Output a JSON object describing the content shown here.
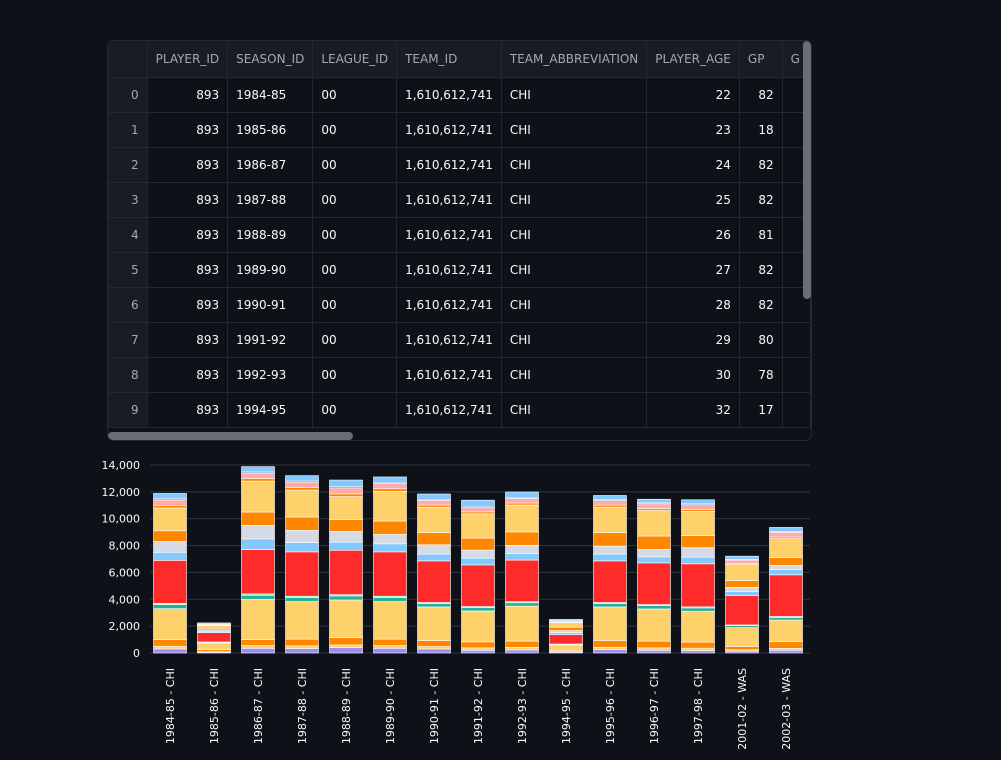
{
  "table": {
    "columns": [
      "",
      "PLAYER_ID",
      "SEASON_ID",
      "LEAGUE_ID",
      "TEAM_ID",
      "TEAM_ABBREVIATION",
      "PLAYER_AGE",
      "GP",
      "G"
    ],
    "rows": [
      [
        "0",
        "893",
        "1984-85",
        "00",
        "1,610,612,741",
        "CHI",
        "22",
        "82",
        ""
      ],
      [
        "1",
        "893",
        "1985-86",
        "00",
        "1,610,612,741",
        "CHI",
        "23",
        "18",
        ""
      ],
      [
        "2",
        "893",
        "1986-87",
        "00",
        "1,610,612,741",
        "CHI",
        "24",
        "82",
        ""
      ],
      [
        "3",
        "893",
        "1987-88",
        "00",
        "1,610,612,741",
        "CHI",
        "25",
        "82",
        ""
      ],
      [
        "4",
        "893",
        "1988-89",
        "00",
        "1,610,612,741",
        "CHI",
        "26",
        "81",
        ""
      ],
      [
        "5",
        "893",
        "1989-90",
        "00",
        "1,610,612,741",
        "CHI",
        "27",
        "82",
        ""
      ],
      [
        "6",
        "893",
        "1990-91",
        "00",
        "1,610,612,741",
        "CHI",
        "28",
        "82",
        ""
      ],
      [
        "7",
        "893",
        "1991-92",
        "00",
        "1,610,612,741",
        "CHI",
        "29",
        "80",
        ""
      ],
      [
        "8",
        "893",
        "1992-93",
        "00",
        "1,610,612,741",
        "CHI",
        "30",
        "78",
        ""
      ],
      [
        "9",
        "893",
        "1994-95",
        "00",
        "1,610,612,741",
        "CHI",
        "32",
        "17",
        ""
      ]
    ]
  },
  "chart_data": {
    "type": "bar",
    "stacked": true,
    "categories": [
      "1984-85 - CHI",
      "1985-86 - CHI",
      "1986-87 - CHI",
      "1987-88 - CHI",
      "1988-89 - CHI",
      "1989-90 - CHI",
      "1990-91 - CHI",
      "1991-92 - CHI",
      "1992-93 - CHI",
      "1994-95 - CHI",
      "1995-96 - CHI",
      "1996-97 - CHI",
      "1997-98 - CHI",
      "2001-02 - WAS",
      "2002-03 - WAS"
    ],
    "ylim": [
      0,
      14000
    ],
    "yticks": [
      0,
      2000,
      4000,
      6000,
      8000,
      10000,
      12000,
      14000
    ],
    "ytick_labels": [
      "0",
      "2,000",
      "4,000",
      "6,000",
      "8,000",
      "10,000",
      "12,000",
      "14,000"
    ],
    "grid": true,
    "series": [
      {
        "color": "#9b8df2",
        "values": [
          300,
          60,
          350,
          330,
          400,
          350,
          300,
          200,
          230,
          60,
          250,
          200,
          180,
          140,
          200
        ]
      },
      {
        "color": "#ffd16a",
        "values": [
          200,
          40,
          200,
          200,
          200,
          200,
          180,
          180,
          190,
          40,
          180,
          180,
          180,
          100,
          150
        ]
      },
      {
        "color": "#ff8700",
        "values": [
          500,
          150,
          450,
          500,
          550,
          480,
          450,
          450,
          470,
          100,
          500,
          500,
          450,
          250,
          500
        ]
      },
      {
        "color": "#ffd16a",
        "values": [
          2300,
          500,
          3000,
          2800,
          2800,
          2800,
          2500,
          2300,
          2600,
          400,
          2500,
          2400,
          2300,
          1400,
          1600
        ]
      },
      {
        "color": "#29b09d",
        "values": [
          300,
          50,
          300,
          300,
          300,
          300,
          250,
          250,
          250,
          50,
          250,
          250,
          250,
          150,
          200
        ]
      },
      {
        "color": "#7defa1",
        "values": [
          100,
          20,
          100,
          100,
          100,
          100,
          80,
          80,
          80,
          20,
          80,
          80,
          80,
          50,
          70
        ]
      },
      {
        "color": "#ff2b2b",
        "values": [
          3200,
          700,
          3300,
          3300,
          3300,
          3300,
          3100,
          3100,
          3100,
          700,
          3100,
          3100,
          3200,
          2200,
          3100
        ]
      },
      {
        "color": "#83c9ff",
        "values": [
          600,
          100,
          800,
          700,
          600,
          600,
          500,
          500,
          500,
          150,
          500,
          450,
          500,
          300,
          400
        ]
      },
      {
        "color": "#d5dae5",
        "values": [
          800,
          100,
          1000,
          900,
          800,
          700,
          700,
          600,
          600,
          150,
          600,
          550,
          700,
          300,
          300
        ]
      },
      {
        "color": "#ff8700",
        "values": [
          800,
          120,
          1000,
          1000,
          900,
          1000,
          900,
          900,
          1000,
          250,
          1000,
          1000,
          900,
          500,
          600
        ]
      },
      {
        "color": "#ffd16a",
        "values": [
          1700,
          200,
          2300,
          2000,
          1700,
          2200,
          1900,
          1800,
          2000,
          350,
          1900,
          1900,
          1800,
          1200,
          1400
        ]
      },
      {
        "color": "#ff8700",
        "values": [
          200,
          40,
          200,
          200,
          200,
          200,
          160,
          150,
          150,
          30,
          150,
          150,
          150,
          80,
          120
        ]
      },
      {
        "color": "#ffabab",
        "values": [
          400,
          60,
          400,
          400,
          450,
          400,
          350,
          350,
          350,
          80,
          350,
          350,
          350,
          250,
          350
        ]
      },
      {
        "color": "#0068c9",
        "values": [
          80,
          20,
          80,
          80,
          80,
          80,
          70,
          70,
          70,
          20,
          70,
          70,
          70,
          40,
          60
        ]
      },
      {
        "color": "#83c9ff",
        "values": [
          400,
          80,
          400,
          400,
          500,
          400,
          400,
          450,
          400,
          100,
          300,
          270,
          300,
          250,
          300
        ]
      }
    ]
  }
}
